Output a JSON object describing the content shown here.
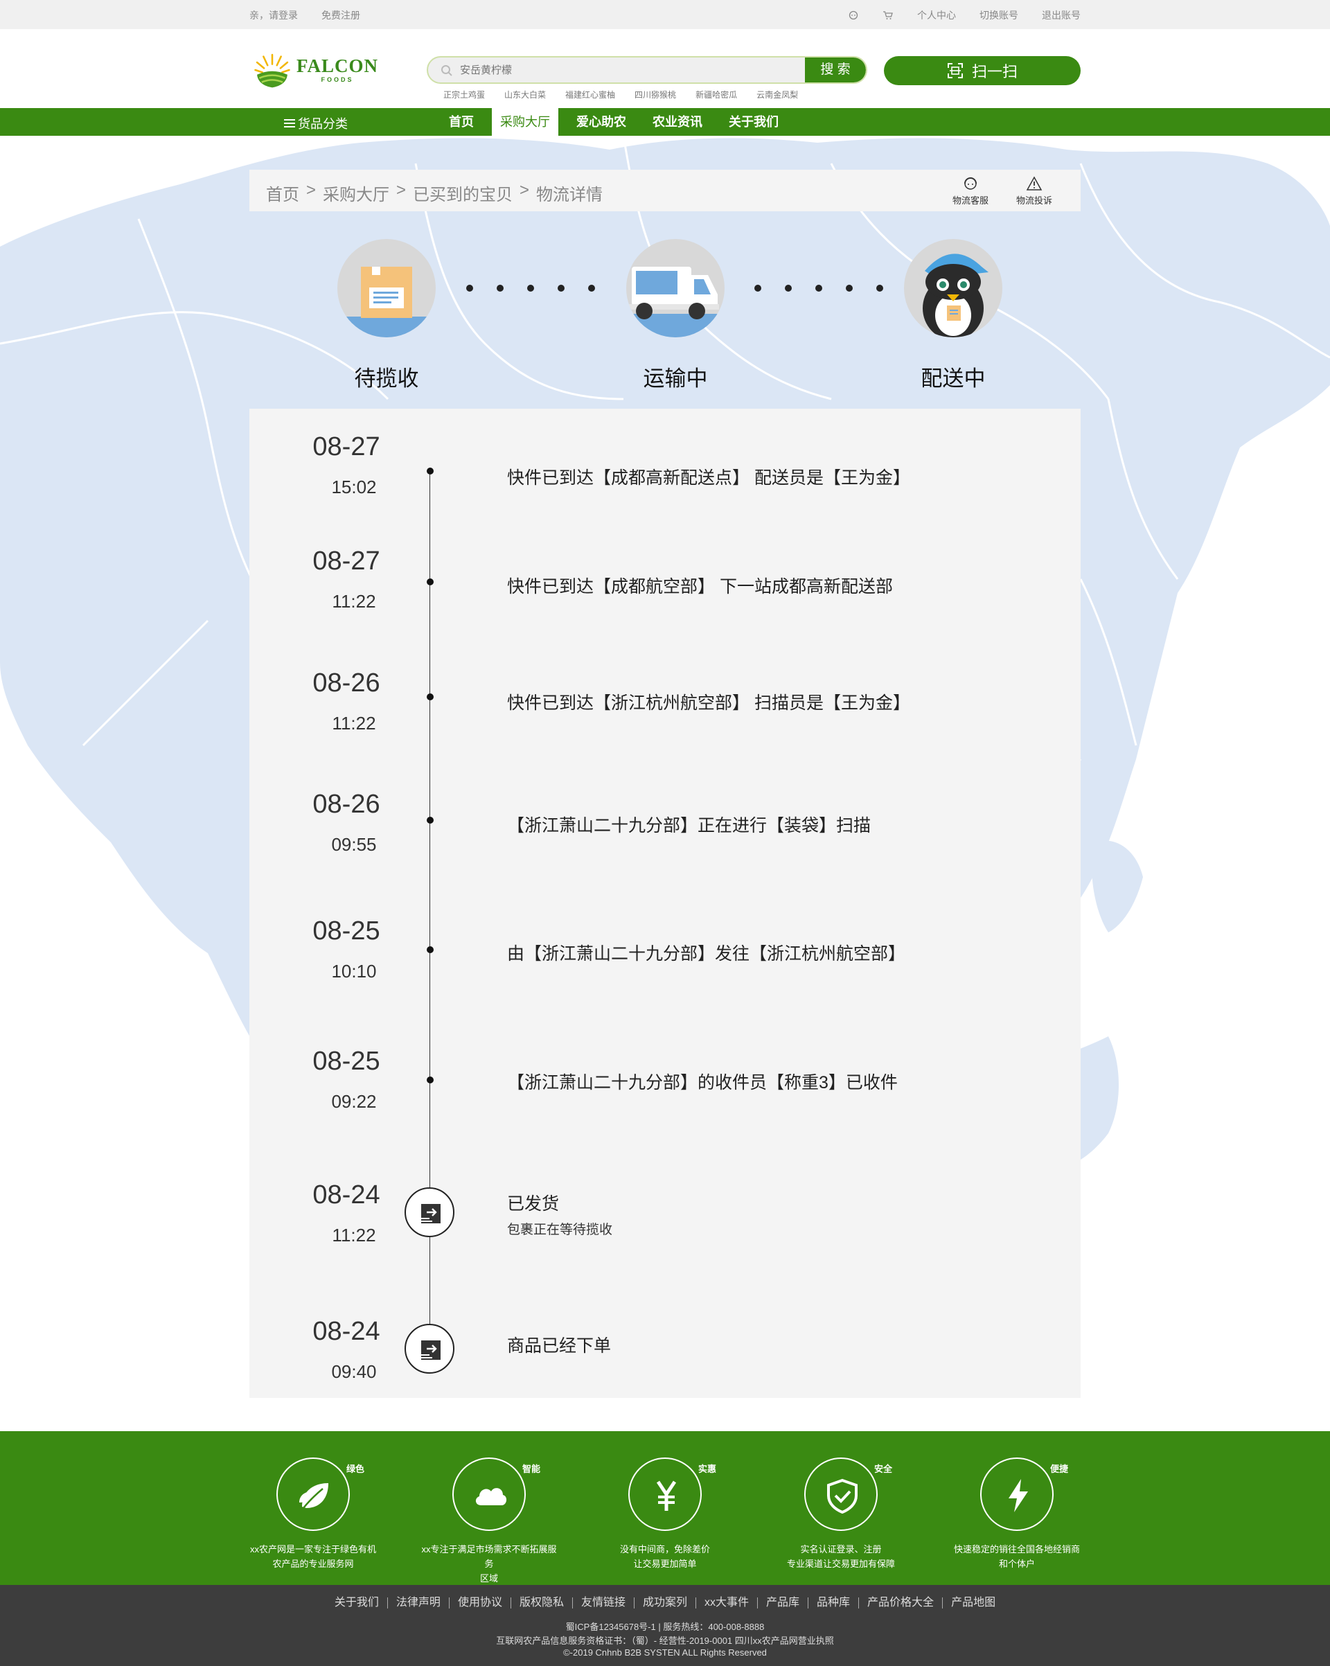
{
  "topbar": {
    "login": "亲，请登录",
    "register": "免费注册",
    "personal_center": "个人中心",
    "switch_account": "切换账号",
    "logout": "退出账号"
  },
  "header": {
    "logo_line1": "FALCON",
    "logo_line2": "FOODS",
    "search_placeholder": "安岳黄柠檬",
    "search_button": "搜 索",
    "hot_words": [
      "正宗土鸡蛋",
      "山东大白菜",
      "福建红心蜜柚",
      "四川猕猴桃",
      "新疆哈密瓜",
      "云南金凤梨"
    ],
    "scan_button": "扫一扫"
  },
  "nav": {
    "category": "货品分类",
    "items": [
      "首页",
      "采购大厅",
      "爱心助农",
      "农业资讯",
      "关于我们"
    ],
    "active_index": 1
  },
  "breadcrumb": {
    "items": [
      "首页",
      "采购大厅",
      "已买到的宝贝",
      "物流详情"
    ],
    "separator": ">",
    "tools": [
      "物流客服",
      "物流投诉"
    ]
  },
  "steps": [
    "待揽收",
    "运输中",
    "配送中"
  ],
  "timeline": [
    {
      "date": "08-27",
      "time": "15:02",
      "text": "快件已到达【成都高新配送点】 配送员是【王为金】"
    },
    {
      "date": "08-27",
      "time": "11:22",
      "text": "快件已到达【成都航空部】 下一站成都高新配送部"
    },
    {
      "date": "08-26",
      "time": "11:22",
      "text": "快件已到达【浙江杭州航空部】 扫描员是【王为金】"
    },
    {
      "date": "08-26",
      "time": "09:55",
      "text": "【浙江萧山二十九分部】正在进行【装袋】扫描"
    },
    {
      "date": "08-25",
      "time": "10:10",
      "text": "由【浙江萧山二十九分部】发往【浙江杭州航空部】"
    },
    {
      "date": "08-25",
      "time": "09:22",
      "text": "【浙江萧山二十九分部】的收件员【称重3】已收件"
    },
    {
      "date": "08-24",
      "time": "11:22",
      "text": "已发货",
      "sub": "包裹正在等待揽收"
    },
    {
      "date": "08-24",
      "time": "09:40",
      "text": "商品已经下单"
    }
  ],
  "features": [
    {
      "tag": "绿色",
      "icon": "leaf-icon",
      "line1": "xx农产网是一家专注于绿色有机",
      "line2": "农产品的专业服务网"
    },
    {
      "tag": "智能",
      "icon": "cloud-icon",
      "line1": "xx专注于满足市场需求不断拓展服务",
      "line2": "区域"
    },
    {
      "tag": "实惠",
      "icon": "yen-icon",
      "line1": "没有中间商，免除差价",
      "line2": "让交易更加简单"
    },
    {
      "tag": "安全",
      "icon": "shield-icon",
      "line1": "实名认证登录、注册",
      "line2": "专业渠道让交易更加有保障"
    },
    {
      "tag": "便捷",
      "icon": "lightning-icon",
      "line1": "快速稳定的销往全国各地经销商",
      "line2": "和个体户"
    }
  ],
  "footer": {
    "links": [
      "关于我们",
      "法律声明",
      "使用协议",
      "版权隐私",
      "友情链接",
      "成功案列",
      "xx大事件",
      "产品库",
      "品种库",
      "产品价格大全",
      "产品地图"
    ],
    "icp": "蜀ICP备12345678号-1 | 服务热线：400-008-8888",
    "license": "互联网农产品信息服务资格证书：（蜀）- 经营性-2019-0001 四川xx农产品网营业执照",
    "copyright": "©-2019 Cnhnb B2B SYSTEN ALL Rights Reserved"
  },
  "colors": {
    "brand_green": "#3a8a12",
    "map_blue": "#dbe6f5",
    "panel_gray": "#f4f4f4",
    "footer_dark": "#3d3d3d"
  }
}
